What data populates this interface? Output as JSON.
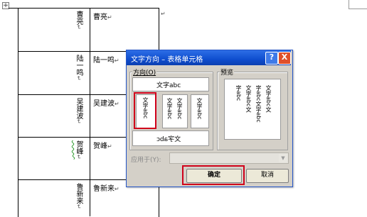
{
  "document": {
    "left_column": [
      {
        "label": "曹亮",
        "mark": "↵"
      },
      {
        "label": "陆一鸣",
        "mark": "↵"
      },
      {
        "label": "吴建波",
        "mark": "↵"
      },
      {
        "label": "贺峰",
        "mark": "↵"
      },
      {
        "label": "鲁新来",
        "mark": "↵"
      }
    ],
    "right_column": [
      {
        "label": "曹亮",
        "mark": "↵"
      },
      {
        "label": "陆一鸣",
        "mark": "↵"
      },
      {
        "label": "吴建波",
        "mark": "↵"
      },
      {
        "label": "贺峰",
        "mark": "↵"
      },
      {
        "label": "鲁新来",
        "mark": "↵"
      }
    ],
    "row_end_mark": "↵",
    "move_handle": "+"
  },
  "dialog": {
    "title": "文字方向 – 表格单元格",
    "help_button": "?",
    "close_button": "X",
    "direction_group_label": "方向(O)",
    "preview_group_label": "预览",
    "options": {
      "horizontal": "文字abc",
      "vertical_rl": "文字abc",
      "vertical_stacked_a": "文字abc",
      "vertical_stacked_b": "文字abc",
      "vertical_lr": "文字abc",
      "rotated_bottom": "文字abc"
    },
    "preview_lines": [
      "文字abc文",
      "字abc文字abc",
      "文字abc文",
      "字abc"
    ],
    "apply_to_label": "应用于(Y):",
    "apply_to_value": "",
    "ok_label": "确定",
    "cancel_label": "取消",
    "highlight_color": "#d0021b"
  }
}
